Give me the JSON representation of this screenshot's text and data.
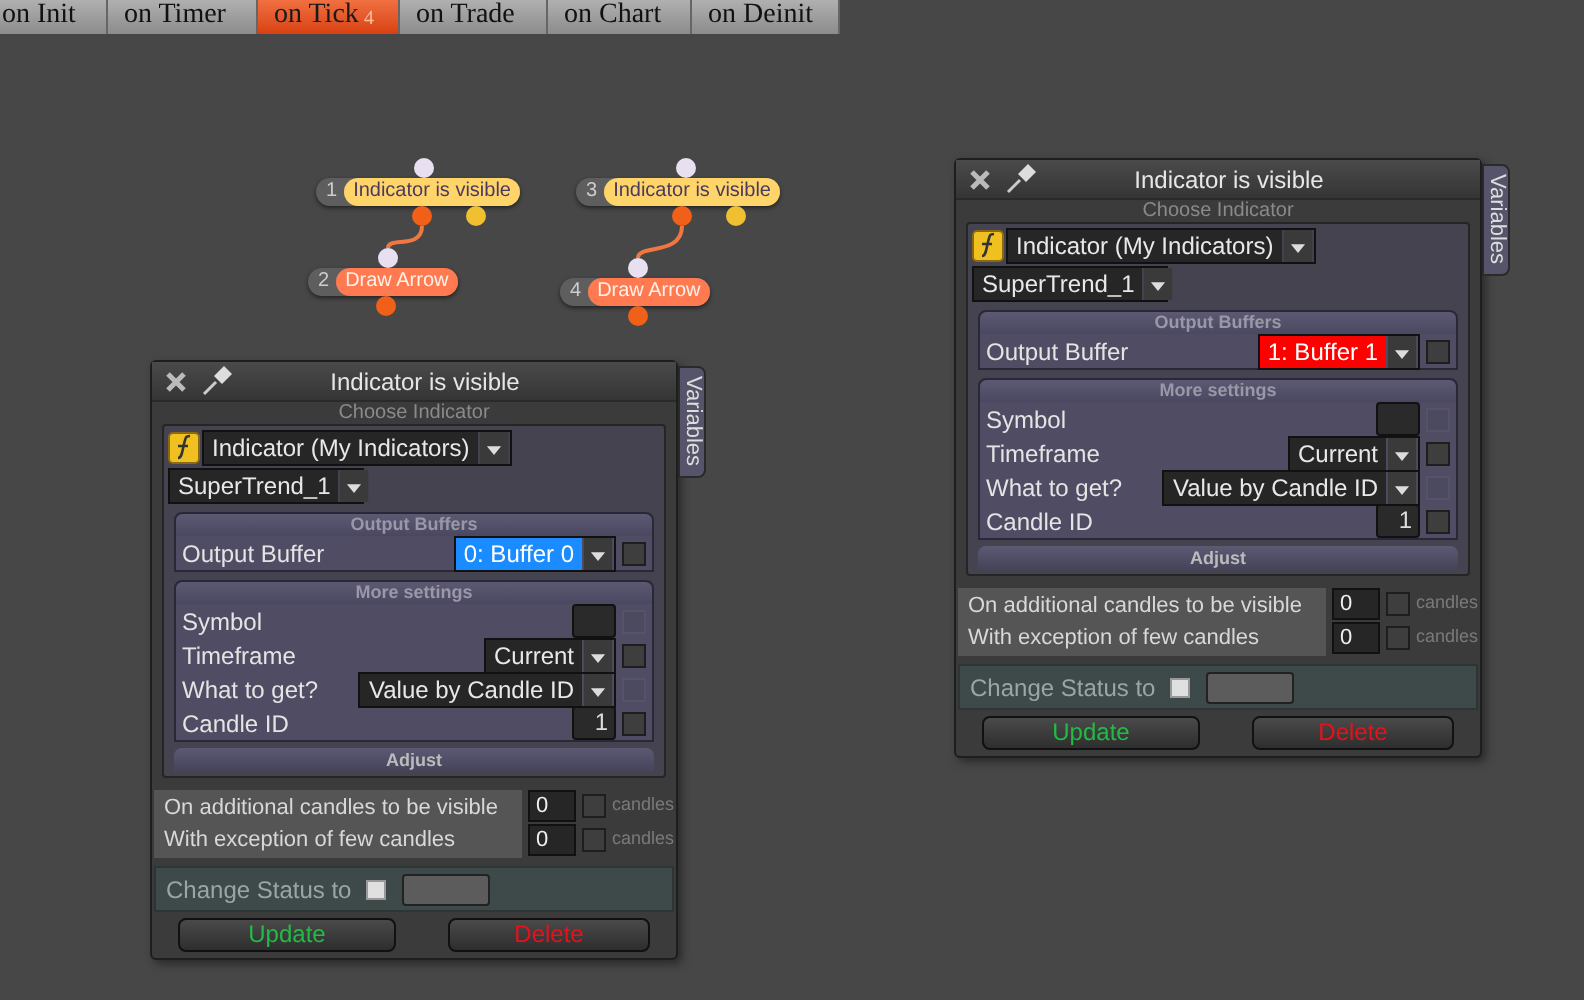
{
  "tabs": [
    {
      "label": "on Init",
      "selected": false
    },
    {
      "label": "on Timer",
      "selected": false
    },
    {
      "label": "on Tick",
      "selected": true,
      "badge": "4"
    },
    {
      "label": "on Trade",
      "selected": false
    },
    {
      "label": "on Chart",
      "selected": false
    },
    {
      "label": "on Deinit",
      "selected": false
    }
  ],
  "nodes": [
    {
      "number": "1",
      "label": "Indicator is visible",
      "kind": "condition"
    },
    {
      "number": "3",
      "label": "Indicator is visible",
      "kind": "condition"
    },
    {
      "number": "2",
      "label": "Draw Arrow",
      "kind": "action"
    },
    {
      "number": "4",
      "label": "Draw Arrow",
      "kind": "action"
    }
  ],
  "panels": [
    {
      "title": "Indicator is visible",
      "side_tab": "Variables",
      "choose_label": "Choose Indicator",
      "indicator_type": "Indicator (My Indicators)",
      "indicator_name": "SuperTrend_1",
      "sections": [
        {
          "title": "Output Buffers",
          "rows": [
            {
              "label": "Output Buffer",
              "kind": "dropdown",
              "value": "0: Buffer 0",
              "color": "#1a8cff",
              "checkbox": {
                "checked": false,
                "disabled": false
              }
            }
          ]
        },
        {
          "title": "More settings",
          "rows": [
            {
              "label": "Symbol",
              "kind": "input",
              "checkbox": {
                "checked": false,
                "disabled": true
              }
            },
            {
              "label": "Timeframe",
              "kind": "dropdown",
              "value": "Current",
              "checkbox": {
                "checked": false,
                "disabled": false
              }
            },
            {
              "label": "What to get?",
              "kind": "dropdown",
              "value": "Value by Candle ID",
              "checkbox": {
                "checked": false,
                "disabled": true
              }
            },
            {
              "label": "Candle ID",
              "kind": "input",
              "value": "1",
              "checkbox": {
                "checked": false,
                "disabled": false
              }
            }
          ]
        }
      ],
      "adjust_label": "Adjust",
      "candle_rows": [
        {
          "label": "On additional candles to be visible",
          "value": "0",
          "checked": false,
          "unit": "candles"
        },
        {
          "label": "With exception of few candles",
          "value": "0",
          "checked": false,
          "unit": "candles"
        }
      ],
      "change_status": {
        "label": "Change Status to",
        "checked": false
      },
      "buttons": [
        {
          "label": "Update",
          "kind": "update"
        },
        {
          "label": "Delete",
          "kind": "delete"
        }
      ]
    },
    {
      "title": "Indicator is visible",
      "side_tab": "Variables",
      "choose_label": "Choose Indicator",
      "indicator_type": "Indicator (My Indicators)",
      "indicator_name": "SuperTrend_1",
      "sections": [
        {
          "title": "Output Buffers",
          "rows": [
            {
              "label": "Output Buffer",
              "kind": "dropdown",
              "value": "1: Buffer 1",
              "color": "#ff0000",
              "checkbox": {
                "checked": false,
                "disabled": false
              }
            }
          ]
        },
        {
          "title": "More settings",
          "rows": [
            {
              "label": "Symbol",
              "kind": "input",
              "checkbox": {
                "checked": false,
                "disabled": true
              }
            },
            {
              "label": "Timeframe",
              "kind": "dropdown",
              "value": "Current",
              "checkbox": {
                "checked": false,
                "disabled": false
              }
            },
            {
              "label": "What to get?",
              "kind": "dropdown",
              "value": "Value by Candle ID",
              "checkbox": {
                "checked": false,
                "disabled": true
              }
            },
            {
              "label": "Candle ID",
              "kind": "input",
              "value": "1",
              "checkbox": {
                "checked": false,
                "disabled": false
              }
            }
          ]
        }
      ],
      "adjust_label": "Adjust",
      "candle_rows": [
        {
          "label": "On additional candles to be visible",
          "value": "0",
          "checked": false,
          "unit": "candles"
        },
        {
          "label": "With exception of few candles",
          "value": "0",
          "checked": false,
          "unit": "candles"
        }
      ],
      "change_status": {
        "label": "Change Status to",
        "checked": false
      },
      "buttons": [
        {
          "label": "Update",
          "kind": "update"
        },
        {
          "label": "Delete",
          "kind": "delete"
        }
      ]
    }
  ]
}
